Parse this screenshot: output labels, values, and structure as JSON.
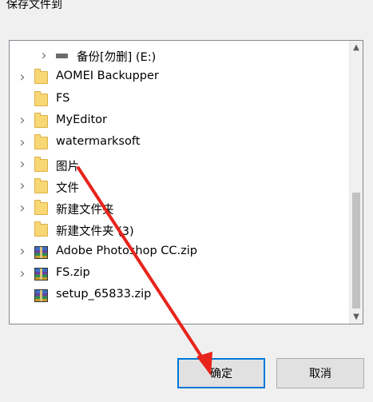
{
  "dialog": {
    "title": "保存文件到"
  },
  "tree": {
    "items": [
      {
        "label": "备份[勿删] (E:)",
        "icon": "drive-icon",
        "expand": true,
        "indent": 1
      },
      {
        "label": "AOMEI Backupper",
        "icon": "folder-icon",
        "expand": true,
        "indent": 0
      },
      {
        "label": "FS",
        "icon": "folder-icon",
        "expand": false,
        "indent": 0
      },
      {
        "label": "MyEditor",
        "icon": "folder-icon",
        "expand": true,
        "indent": 0
      },
      {
        "label": "watermarksoft",
        "icon": "folder-icon",
        "expand": true,
        "indent": 0
      },
      {
        "label": "图片",
        "icon": "folder-icon",
        "expand": true,
        "indent": 0
      },
      {
        "label": "文件",
        "icon": "folder-icon",
        "expand": true,
        "indent": 0
      },
      {
        "label": "新建文件夹",
        "icon": "folder-icon",
        "expand": true,
        "indent": 0
      },
      {
        "label": "新建文件夹 (3)",
        "icon": "folder-icon",
        "expand": false,
        "indent": 0
      },
      {
        "label": "Adobe Photoshop CC.zip",
        "icon": "zip-icon",
        "expand": true,
        "indent": 0
      },
      {
        "label": "FS.zip",
        "icon": "zip-icon",
        "expand": true,
        "indent": 0
      },
      {
        "label": "setup_65833.zip",
        "icon": "zip-icon",
        "expand": false,
        "indent": 0
      }
    ]
  },
  "buttons": {
    "ok": "确定",
    "cancel": "取消"
  },
  "colors": {
    "arrow": "#e8231b",
    "focus": "#0078d7"
  }
}
